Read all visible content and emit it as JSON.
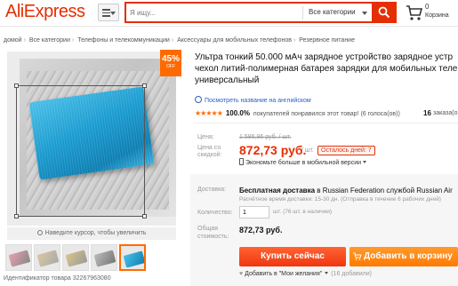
{
  "header": {
    "logo_part1": "Ali",
    "logo_part2": "Express",
    "search_placeholder": "Я ищу...",
    "category_select": "Все категории",
    "cart_count": "0",
    "cart_label": "Корзина"
  },
  "breadcrumb": [
    "домой",
    "Все категории",
    "Телефоны и телекоммуникации",
    "Аксессуары для мобильных телефонов",
    "Резервное питание"
  ],
  "gallery": {
    "discount_pct": "45%",
    "discount_off": "OFF",
    "zoom_hint": "Наведите курсор, чтобы увеличить",
    "thumb_count": 5,
    "active_thumb": 4,
    "item_id": "Идентификатор товара 32267963080"
  },
  "product": {
    "title_lines": [
      "Ультра тонкий 50.000 мАч зарядное устройство зарядное устр",
      "чехол литий-полимерная батарея зарядки для мобильных теле",
      "универсальный"
    ],
    "translate_link": "Посмотреть название на английском",
    "rating_stars": "★★★★★",
    "rating_pct": "100.0%",
    "rating_text": "покупателей понравился этот товар! (6 голоса(ов))",
    "orders_num": "16",
    "orders_label": "заказа(о"
  },
  "price": {
    "price_label": "Цена:",
    "old_price": "1 586,96 руб. / шт.",
    "discount_label_1": "Цена со",
    "discount_label_2": "скидкой:",
    "new_price": "872,73 руб.",
    "unit": "/ шт.",
    "days_left": "Осталось дней: 7",
    "mobile_save": "Экономьте больше в мобильной версии"
  },
  "shipping": {
    "label": "Доставка:",
    "free": "Бесплатная доставка",
    "to": "в Russian Federation службой Russian Air",
    "sub": "Расчётное время доставки: 15-30 дн. (Отправка в течение 6 рабочих дней)"
  },
  "quantity": {
    "label": "Количество:",
    "value": "1",
    "available": "шт. (76 шт. в наличии)"
  },
  "total": {
    "label_1": "Общая",
    "label_2": "стоимость:",
    "value": "872,73 руб."
  },
  "actions": {
    "buy_now": "Купить сейчас",
    "add_to_cart": "Добавить в корзину",
    "wishlist": "Добавить в \"Мои желания\"",
    "wishlist_count": "(16 добавили)"
  },
  "colors": {
    "brand": "#e62e04",
    "buy": "#f0360f",
    "cart": "#ff7a00",
    "stars": "#ff6a00",
    "link": "#2962c4"
  }
}
